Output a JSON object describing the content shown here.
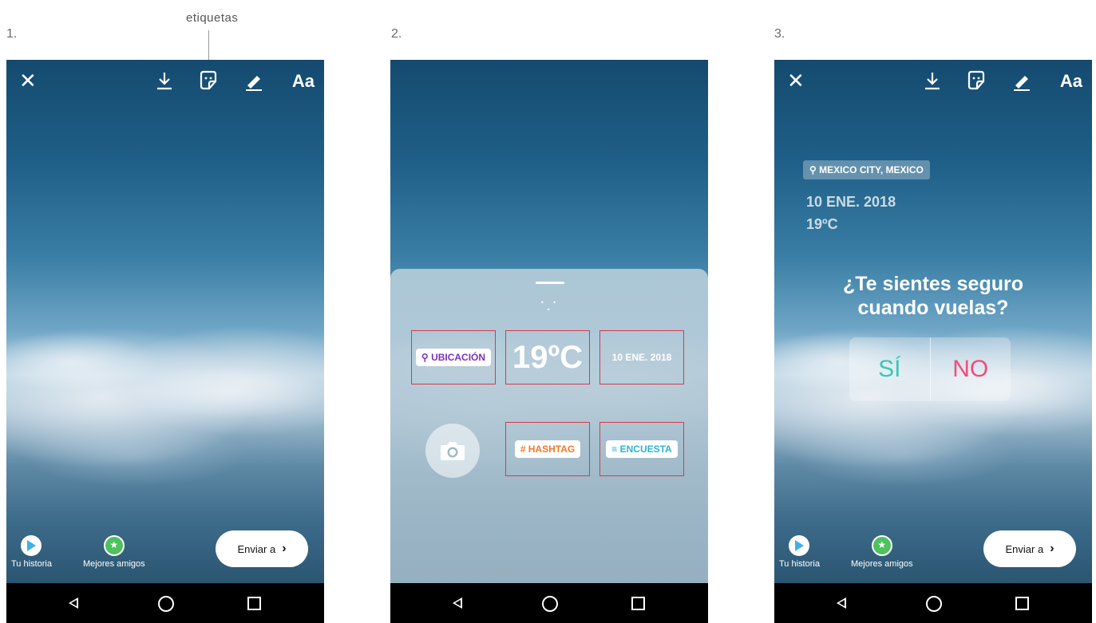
{
  "callout": {
    "label": "etiquetas"
  },
  "steps": [
    "1.",
    "2.",
    "3."
  ],
  "editor": {
    "aa_label": "Aa",
    "close_glyph": "✕",
    "icons": [
      "close-icon",
      "download-icon",
      "sticker-icon",
      "draw-icon",
      "text-icon"
    ]
  },
  "share": {
    "your_story": "Tu historia",
    "close_friends": "Mejores amigos",
    "send_to": "Enviar a",
    "send_chevron": "›"
  },
  "tray": {
    "location_sticker": "UBICACIÓN",
    "temperature_sticker": "19ºC",
    "date_sticker": "10 ENE. 2018",
    "hashtag_sticker": "# HASHTAG",
    "poll_sticker": "ENCUESTA",
    "dots": "• • •"
  },
  "story": {
    "location": "MEXICO CITY, MEXICO",
    "date": "10 ENE. 2018",
    "temperature": "19ºC",
    "question_line1": "¿Te sientes seguro",
    "question_line2": "cuando vuelas?",
    "poll_yes": "SÍ",
    "poll_no": "NO"
  },
  "colors": {
    "highlight_border": "#d63a4a",
    "location_purple": "#7b2fbf",
    "hashtag_orange": "#f07b2a",
    "poll_cyan": "#2ab3d6",
    "yes_teal": "#3ec6b3",
    "no_pink": "#f04d7a"
  }
}
